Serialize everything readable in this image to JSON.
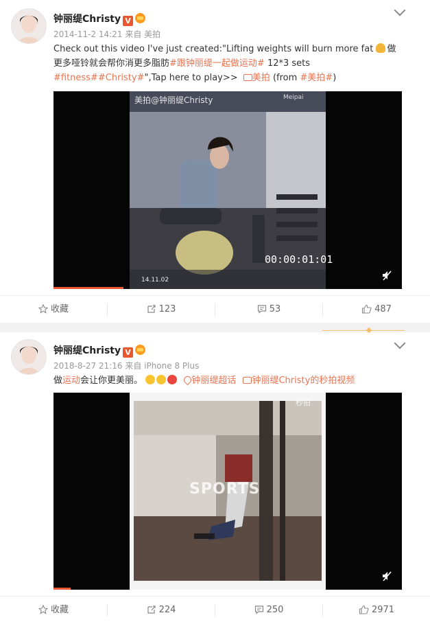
{
  "posts": [
    {
      "username": "钟丽缇Christy",
      "badge": "V",
      "meta": "2014-11-2 14:21 来自 美拍",
      "text_a": "Check out this video I've just created:\"Lifting weights will burn more fat ",
      "text_b": "做更多哑铃就会帮你消更多脂肪",
      "tag1": "#跟钟丽缇一起做运动#",
      "text_c": " 12*3 sets ",
      "tag2": "#fitness##Christy#",
      "text_d": "\",Tap here to play>>",
      "link1": "美拍",
      "text_e": " (from ",
      "link2": "#美拍#",
      "text_f": ")",
      "video_watermark": "美拍@钟丽缇Christy",
      "video_brand": "Meipai",
      "video_timecode": "00:00:01:01",
      "video_date": "14.11.02",
      "progress": 0.2,
      "actions": {
        "fav": "收藏",
        "repost": "123",
        "comment": "53",
        "like": "487"
      }
    },
    {
      "username": "钟丽缇Christy",
      "badge": "V",
      "meta": "2018-8-27 21:16 来自 iPhone 8 Plus",
      "text_a": "做",
      "link1": "运动",
      "text_b": "会让你更美丽。",
      "super_topic": "钟丽缇超话",
      "video_link": "钟丽缇Christy的秒拍视频",
      "video_brand": "秒拍",
      "video_caption": "SPORTS",
      "progress": 0.05,
      "actions": {
        "fav": "收藏",
        "repost": "224",
        "comment": "250",
        "like": "2971"
      }
    }
  ],
  "colors": {
    "accent": "#eb7350",
    "badge": "#e8572d",
    "muted": "#999999"
  },
  "icons": [
    "star-icon",
    "repost-icon",
    "comment-icon",
    "like-icon",
    "chevron-down-icon",
    "mute-icon",
    "verified-badge-icon"
  ]
}
